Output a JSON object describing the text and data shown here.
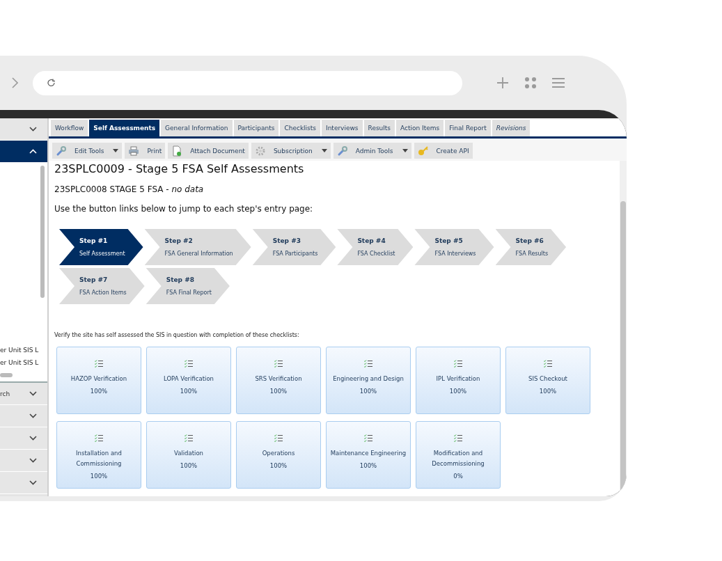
{
  "sidebar": {
    "sections": [
      {
        "expanded": false
      },
      {
        "expanded": true,
        "items": [
          "er Unit SIS L",
          "er Unit SIS L"
        ]
      },
      {
        "label": "rch",
        "expanded": false
      },
      {
        "expanded": false
      },
      {
        "expanded": false
      },
      {
        "expanded": false
      },
      {
        "expanded": false
      }
    ]
  },
  "tabs": [
    {
      "label": "Workflow",
      "selected": false,
      "italic": false
    },
    {
      "label": "Self Assessments",
      "selected": true,
      "italic": false
    },
    {
      "label": "General Information",
      "selected": false,
      "italic": false
    },
    {
      "label": "Participants",
      "selected": false,
      "italic": false
    },
    {
      "label": "Checklists",
      "selected": false,
      "italic": false
    },
    {
      "label": "Interviews",
      "selected": false,
      "italic": false
    },
    {
      "label": "Results",
      "selected": false,
      "italic": false
    },
    {
      "label": "Action Items",
      "selected": false,
      "italic": false
    },
    {
      "label": "Final Report",
      "selected": false,
      "italic": false
    },
    {
      "label": "Revisions",
      "selected": false,
      "italic": true
    }
  ],
  "toolbar": [
    {
      "label": "Edit Tools",
      "dropdown": true
    },
    {
      "label": "Print",
      "dropdown": false
    },
    {
      "label": "Attach Document",
      "dropdown": false
    },
    {
      "label": "Subscription",
      "dropdown": true
    },
    {
      "label": "Admin Tools",
      "dropdown": true
    },
    {
      "label": "Create API",
      "dropdown": false
    }
  ],
  "page": {
    "title": "23SPLC0009 - Stage 5 FSA Self Assessments",
    "subtitle": "23SPLC0008 STAGE 5 FSA - *no data*",
    "instruction": "Use the button links below to jump to each step's entry page:",
    "steps": [
      {
        "step": "Step #1",
        "name": "Self Assessment",
        "selected": true
      },
      {
        "step": "Step #2",
        "name": "FSA General Information",
        "selected": false
      },
      {
        "step": "Step #3",
        "name": "FSA Participants",
        "selected": false
      },
      {
        "step": "Step #4",
        "name": "FSA Checklist",
        "selected": false
      },
      {
        "step": "Step #5",
        "name": "FSA Interviews",
        "selected": false
      },
      {
        "step": "Step #6",
        "name": "FSA Results",
        "selected": false
      },
      {
        "step": "Step #7",
        "name": "FSA Action Items",
        "selected": false
      },
      {
        "step": "Step #8",
        "name": "FSA Final Report",
        "selected": false
      }
    ],
    "note": "Verify the site has self assessed the SIS in question with completion of these checklists:",
    "checklists": [
      {
        "name": "HAZOP Verification",
        "percent": "100%"
      },
      {
        "name": "LOPA Verification",
        "percent": "100%"
      },
      {
        "name": "SRS Verification",
        "percent": "100%"
      },
      {
        "name": "Engineering and Design",
        "percent": "100%"
      },
      {
        "name": "IPL Verification",
        "percent": "100%"
      },
      {
        "name": "SIS Checkout",
        "percent": "100%"
      },
      {
        "name": "Installation and Commissioning",
        "percent": "100%"
      },
      {
        "name": "Validation",
        "percent": "100%"
      },
      {
        "name": "Operations",
        "percent": "100%"
      },
      {
        "name": "Maintenance Engineering",
        "percent": "100%"
      },
      {
        "name": "Modification and Decommissioning",
        "percent": "0%"
      }
    ]
  }
}
